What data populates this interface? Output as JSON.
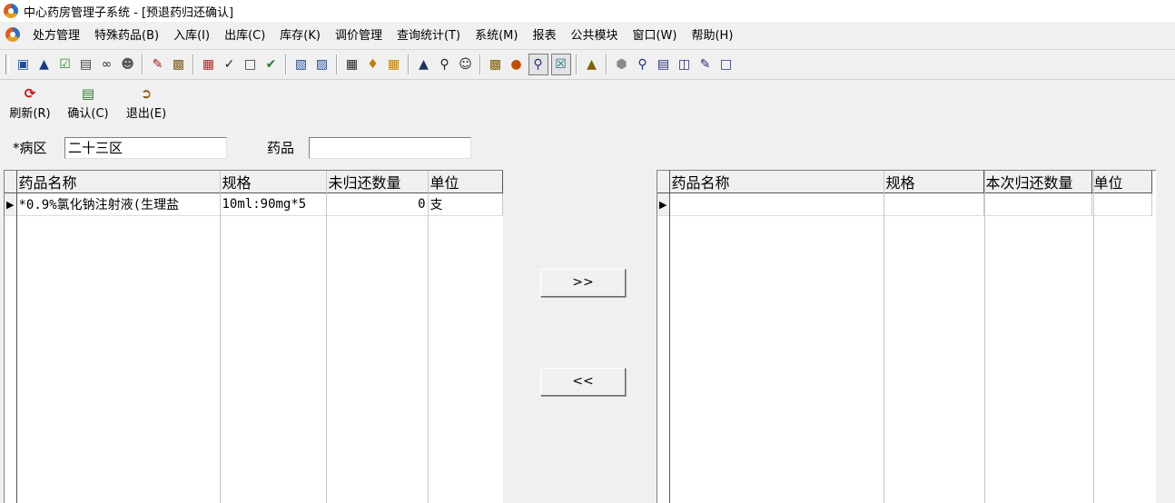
{
  "window": {
    "title": "中心药房管理子系统 - [预退药归还确认]"
  },
  "menu": [
    "处方管理",
    "特殊药品(B)",
    "入库(I)",
    "出库(C)",
    "库存(K)",
    "调价管理",
    "查询统计(T)",
    "系统(M)",
    "报表",
    "公共模块",
    "窗口(W)",
    "帮助(H)"
  ],
  "actions": {
    "refresh": "刷新(R)",
    "confirm": "确认(C)",
    "exit": "退出(E)"
  },
  "filters": {
    "ward_label": "*病区",
    "ward_value": "二十三区",
    "drug_label": "药品",
    "drug_value": ""
  },
  "left_grid": {
    "columns": [
      "药品名称",
      "规格",
      "未归还数量",
      "单位"
    ],
    "rows": [
      {
        "name": "*0.9%氯化钠注射液(生理盐",
        "spec": "10ml:90mg*5",
        "qty": "0",
        "unit": "支"
      }
    ]
  },
  "right_grid": {
    "columns": [
      "药品名称",
      "规格",
      "本次归还数量",
      "单位"
    ]
  },
  "buttons": {
    "move_right": ">>",
    "move_left": "<<"
  }
}
